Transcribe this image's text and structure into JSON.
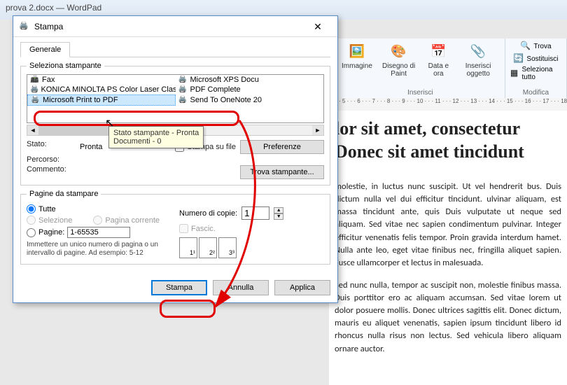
{
  "wordpad": {
    "title": "prova 2.docx — WordPad",
    "ribbon": {
      "insert_group_label": "Inserisci",
      "edit_group_label": "Modifica",
      "immagine": "Immagine",
      "disegno": "Disegno di Paint",
      "data": "Data e ora",
      "oggetto": "Inserisci oggetto",
      "trova": "Trova",
      "sostituisci": "Sostituisci",
      "seleziona": "Seleziona tutto"
    },
    "ruler": "· 5 · · · 6 · · · 7 · · · 8 · · · 9 · · · 10 · · · 11 · · · 12 · · · 13 · · · 14 · · · 15 · · · 16 · · · 17 · · · 18",
    "heading": "lor sit amet, consectetur Donec sit amet tincidunt",
    "para1": "molestie, in luctus nunc suscipit. Ut vel hendrerit bus. Duis dictum nulla vel dui efficitur tincidunt. ulvinar aliquam, est massa tincidunt ante, quis Duis vulputate ut neque sed aliquam. Sed vitae nec sapien condimentum pulvinar. Integer efficitur venenatis felis tempor. Proin gravida interdum hamet. Nulla ante leo, eget vitae finibus nec, fringilla aliquet sapien. Fusce ullamcorper et lectus in malesuada.",
    "para2": "Sed nunc nulla, tempor ac suscipit non, molestie finibus massa. Duis porttitor ero ac aliquam accumsan. Sed vitae lorem ut dolor posuere mollis. Donec ultrices sagittis elit. Donec dictum, mauris eu aliquet venenatis, sapien ipsum tincidunt libero id rhoncus nulla risus non lectus. Sed vehicula libero aliquam ornare auctor."
  },
  "dialog": {
    "title": "Stampa",
    "tab_general": "Generale",
    "select_printer_label": "Seleziona stampante",
    "printers": {
      "fax": "Fax",
      "xps": "Microsoft XPS Docu",
      "konica": "KONICA MINOLTA PS Color Laser Class Driver",
      "pdfcomplete": "PDF Complete",
      "msprint": "Microsoft Print to PDF",
      "onenote": "Send To OneNote 20"
    },
    "tooltip_line1": "Stato stampante - Pronta",
    "tooltip_line2": "Documenti - 0",
    "status_label": "Stato:",
    "status_value": "Pronta",
    "print_to_file": "Stampa su file",
    "prefs_btn": "Preferenze",
    "location_label": "Percorso:",
    "comment_label": "Commento:",
    "find_printer_btn": "Trova stampante...",
    "pages_legend": "Pagine da stampare",
    "all": "Tutte",
    "selection": "Selezione",
    "current": "Pagina corrente",
    "pages": "Pagine:",
    "pages_range": "1-65535",
    "pages_hint": "Immettere un unico numero di pagina o un intervallo di pagine. Ad esempio: 5-12",
    "copies_label": "Numero di copie:",
    "copies_value": "1",
    "collate": "Fascic.",
    "stack1": "1¹",
    "stack2": "2²",
    "stack3": "3³",
    "btn_print": "Stampa",
    "btn_cancel": "Annulla",
    "btn_apply": "Applica"
  }
}
